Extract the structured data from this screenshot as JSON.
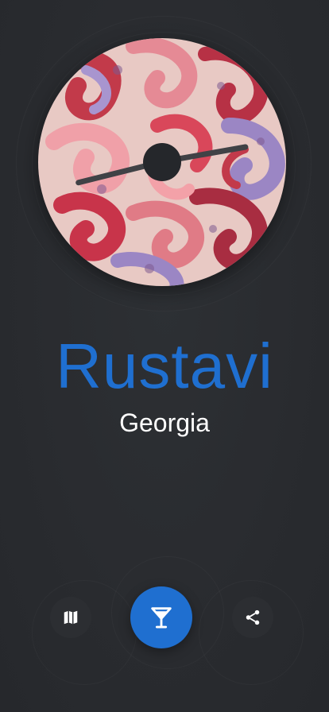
{
  "location": {
    "city": "Rustavi",
    "country": "Georgia"
  },
  "actions": {
    "map_icon": "map-icon",
    "drink_icon": "cocktail-glass-icon",
    "share_icon": "share-icon"
  },
  "colors": {
    "accent": "#1f6fd0",
    "background": "#2a2c30",
    "text": "#ffffff"
  }
}
